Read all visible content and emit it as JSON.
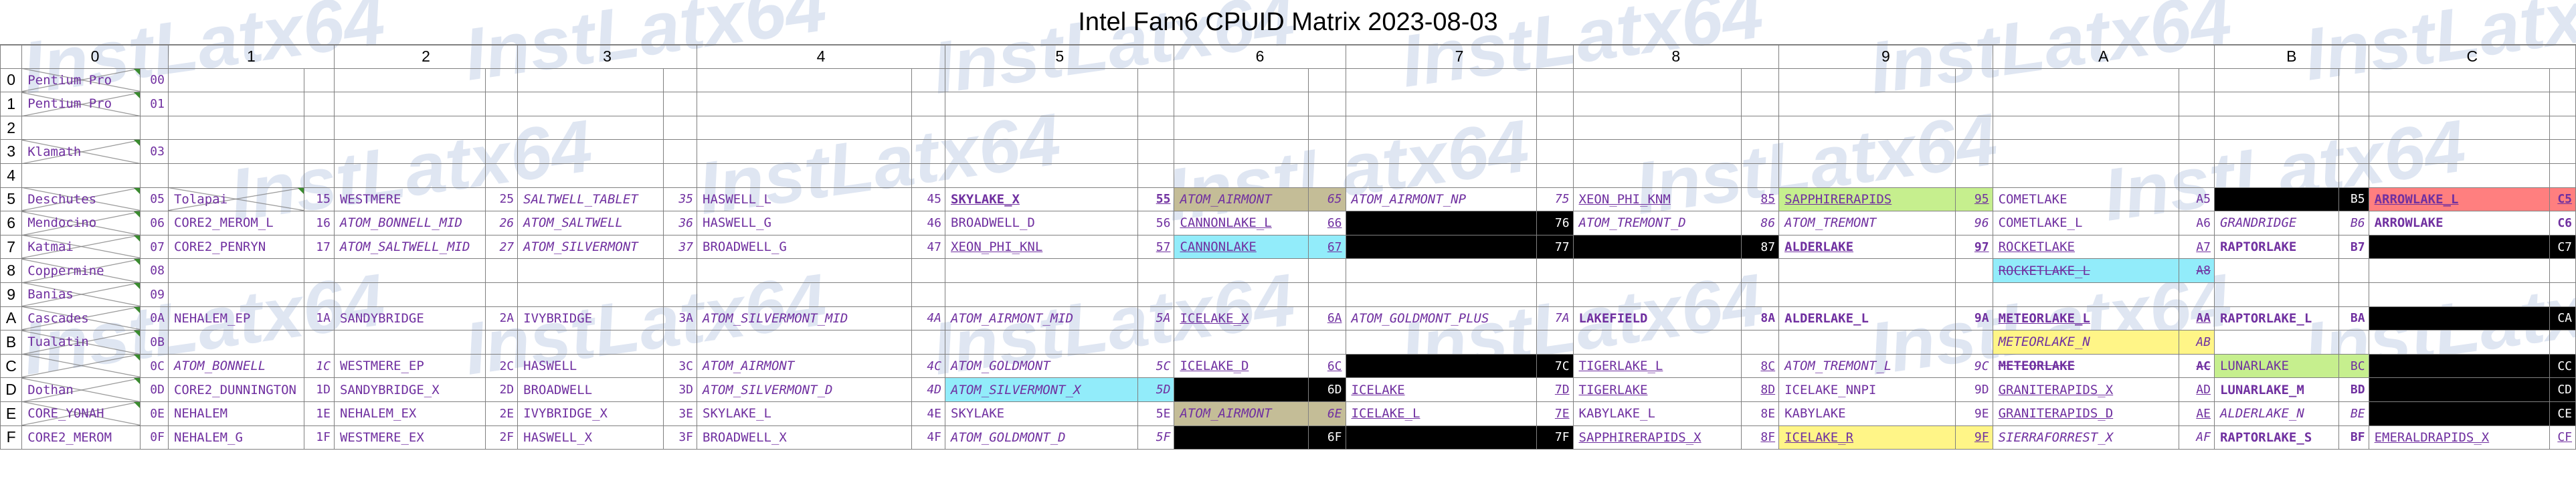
{
  "title": "Intel Fam6 CPUID Matrix 2023-08-03",
  "watermark": "InstLatx64",
  "colors": {
    "text": "#7030a0",
    "grid": "#808080",
    "black": "#000000",
    "tan": "#c4bd97",
    "cyan": "#92ecfa",
    "green": "#c6ef8e",
    "yellow": "#fff587",
    "red": "#ff7f7f"
  },
  "col_headers": [
    "0",
    "1",
    "2",
    "3",
    "4",
    "5",
    "6",
    "7",
    "8",
    "9",
    "A",
    "B",
    "C"
  ],
  "row_headers": [
    "0",
    "1",
    "2",
    "3",
    "4",
    "5",
    "6",
    "7",
    "8",
    "9",
    "A",
    "B",
    "C",
    "D",
    "E",
    "F"
  ],
  "rows": [
    [
      [
        "Pentium Pro",
        "00",
        "",
        "x"
      ],
      [
        "",
        "",
        "",
        ""
      ],
      [
        "",
        "",
        "",
        ""
      ],
      [
        "",
        "",
        "",
        ""
      ],
      [
        "",
        "",
        "",
        ""
      ],
      [
        "",
        "",
        "",
        ""
      ],
      [
        "",
        "",
        "",
        ""
      ],
      [
        "",
        "",
        "",
        ""
      ],
      [
        "",
        "",
        "",
        ""
      ],
      [
        "",
        "",
        "",
        ""
      ],
      [
        "",
        "",
        "",
        ""
      ],
      [
        "",
        "",
        "",
        ""
      ],
      [
        "",
        "",
        "",
        ""
      ]
    ],
    [
      [
        "Pentium Pro",
        "01",
        "",
        "x"
      ],
      [
        "",
        "",
        "",
        ""
      ],
      [
        "",
        "",
        "",
        ""
      ],
      [
        "",
        "",
        "",
        ""
      ],
      [
        "",
        "",
        "",
        ""
      ],
      [
        "",
        "",
        "",
        ""
      ],
      [
        "",
        "",
        "",
        ""
      ],
      [
        "",
        "",
        "",
        ""
      ],
      [
        "",
        "",
        "",
        ""
      ],
      [
        "",
        "",
        "",
        ""
      ],
      [
        "",
        "",
        "",
        ""
      ],
      [
        "",
        "",
        "",
        ""
      ],
      [
        "",
        "",
        "",
        ""
      ]
    ],
    [
      [
        "",
        "",
        "",
        ""
      ],
      [
        "",
        "",
        "",
        ""
      ],
      [
        "",
        "",
        "",
        ""
      ],
      [
        "",
        "",
        "",
        ""
      ],
      [
        "",
        "",
        "",
        ""
      ],
      [
        "",
        "",
        "",
        ""
      ],
      [
        "",
        "",
        "",
        ""
      ],
      [
        "",
        "",
        "",
        ""
      ],
      [
        "",
        "",
        "",
        ""
      ],
      [
        "",
        "",
        "",
        ""
      ],
      [
        "",
        "",
        "",
        ""
      ],
      [
        "",
        "",
        "",
        ""
      ],
      [
        "",
        "",
        "",
        ""
      ]
    ],
    [
      [
        "Klamath",
        "03",
        "",
        "x"
      ],
      [
        "",
        "",
        "",
        ""
      ],
      [
        "",
        "",
        "",
        ""
      ],
      [
        "",
        "",
        "",
        ""
      ],
      [
        "",
        "",
        "",
        ""
      ],
      [
        "",
        "",
        "",
        ""
      ],
      [
        "",
        "",
        "",
        ""
      ],
      [
        "",
        "",
        "",
        ""
      ],
      [
        "",
        "",
        "",
        ""
      ],
      [
        "",
        "",
        "",
        ""
      ],
      [
        "",
        "",
        "",
        ""
      ],
      [
        "",
        "",
        "",
        ""
      ],
      [
        "",
        "",
        "",
        ""
      ]
    ],
    [
      [
        "",
        "",
        "",
        ""
      ],
      [
        "",
        "",
        "",
        ""
      ],
      [
        "",
        "",
        "",
        ""
      ],
      [
        "",
        "",
        "",
        ""
      ],
      [
        "",
        "",
        "",
        ""
      ],
      [
        "",
        "",
        "",
        ""
      ],
      [
        "",
        "",
        "",
        ""
      ],
      [
        "",
        "",
        "",
        ""
      ],
      [
        "",
        "",
        "",
        ""
      ],
      [
        "",
        "",
        "",
        ""
      ],
      [
        "",
        "",
        "",
        ""
      ],
      [
        "",
        "",
        "",
        ""
      ],
      [
        "",
        "",
        "",
        ""
      ]
    ],
    [
      [
        "Deschutes",
        "05",
        "",
        "x"
      ],
      [
        "Tolapai",
        "15",
        "",
        "x"
      ],
      [
        "WESTMERE",
        "25",
        "",
        ""
      ],
      [
        "SALTWELL_TABLET",
        "35",
        "",
        "i"
      ],
      [
        "HASWELL_L",
        "45",
        "",
        ""
      ],
      [
        "SKYLAKE_X",
        "55",
        "",
        "u b"
      ],
      [
        "ATOM_AIRMONT",
        "65",
        "tan",
        "i"
      ],
      [
        "ATOM_AIRMONT_NP",
        "75",
        "",
        "i"
      ],
      [
        "XEON_PHI_KNM",
        "85",
        "",
        "u"
      ],
      [
        "SAPPHIRERAPIDS",
        "95",
        "green",
        "u"
      ],
      [
        "COMETLAKE",
        "A5",
        "",
        ""
      ],
      [
        "",
        "B5",
        "black",
        ""
      ],
      [
        "ARROWLAKE_L",
        "C5",
        "red",
        "u b"
      ]
    ],
    [
      [
        "Mendocino",
        "06",
        "",
        "x"
      ],
      [
        "CORE2_MEROM_L",
        "16",
        "",
        ""
      ],
      [
        "ATOM_BONNELL_MID",
        "26",
        "",
        "i"
      ],
      [
        "ATOM_SALTWELL",
        "36",
        "",
        "i"
      ],
      [
        "HASWELL_G",
        "46",
        "",
        ""
      ],
      [
        "BROADWELL_D",
        "56",
        "",
        ""
      ],
      [
        "CANNONLAKE_L",
        "66",
        "",
        "u"
      ],
      [
        "",
        "76",
        "black",
        ""
      ],
      [
        "ATOM_TREMONT_D",
        "86",
        "",
        "i"
      ],
      [
        "ATOM_TREMONT",
        "96",
        "",
        "i"
      ],
      [
        "COMETLAKE_L",
        "A6",
        "",
        ""
      ],
      [
        "GRANDRIDGE",
        "B6",
        "",
        "i"
      ],
      [
        "ARROWLAKE",
        "C6",
        "",
        "b"
      ]
    ],
    [
      [
        "Katmai",
        "07",
        "",
        "x"
      ],
      [
        "CORE2_PENRYN",
        "17",
        "",
        ""
      ],
      [
        "ATOM_SALTWELL_MID",
        "27",
        "",
        "i"
      ],
      [
        "ATOM_SILVERMONT",
        "37",
        "",
        "i"
      ],
      [
        "BROADWELL_G",
        "47",
        "",
        ""
      ],
      [
        "XEON_PHI_KNL",
        "57",
        "",
        "u"
      ],
      [
        "CANNONLAKE",
        "67",
        "cyan",
        "u"
      ],
      [
        "",
        "77",
        "black",
        ""
      ],
      [
        "",
        "87",
        "black",
        ""
      ],
      [
        "ALDERLAKE",
        "97",
        "",
        "u b"
      ],
      [
        "ROCKETLAKE",
        "A7",
        "",
        "u"
      ],
      [
        "RAPTORLAKE",
        "B7",
        "",
        "b"
      ],
      [
        "",
        "C7",
        "black",
        ""
      ]
    ],
    [
      [
        "Coppermine",
        "08",
        "",
        "x"
      ],
      [
        "",
        "",
        "",
        ""
      ],
      [
        "",
        "",
        "",
        ""
      ],
      [
        "",
        "",
        "",
        ""
      ],
      [
        "",
        "",
        "",
        ""
      ],
      [
        "",
        "",
        "",
        ""
      ],
      [
        "",
        "",
        "",
        ""
      ],
      [
        "",
        "",
        "",
        ""
      ],
      [
        "",
        "",
        "",
        ""
      ],
      [
        "",
        "",
        "",
        ""
      ],
      [
        "ROCKETLAKE_L",
        "A8",
        "cyan",
        "u s"
      ],
      [
        "",
        "",
        "",
        ""
      ],
      [
        "",
        "",
        "",
        ""
      ]
    ],
    [
      [
        "Banias",
        "09",
        "",
        "x"
      ],
      [
        "",
        "",
        "",
        ""
      ],
      [
        "",
        "",
        "",
        ""
      ],
      [
        "",
        "",
        "",
        ""
      ],
      [
        "",
        "",
        "",
        ""
      ],
      [
        "",
        "",
        "",
        ""
      ],
      [
        "",
        "",
        "",
        ""
      ],
      [
        "",
        "",
        "",
        ""
      ],
      [
        "",
        "",
        "",
        ""
      ],
      [
        "",
        "",
        "",
        ""
      ],
      [
        "",
        "",
        "",
        ""
      ],
      [
        "",
        "",
        "",
        ""
      ],
      [
        "",
        "",
        "",
        ""
      ]
    ],
    [
      [
        "Cascades",
        "0A",
        "",
        "x"
      ],
      [
        "NEHALEM_EP",
        "1A",
        "",
        ""
      ],
      [
        "SANDYBRIDGE",
        "2A",
        "",
        ""
      ],
      [
        "IVYBRIDGE",
        "3A",
        "",
        ""
      ],
      [
        "ATOM_SILVERMONT_MID",
        "4A",
        "",
        "i"
      ],
      [
        "ATOM_AIRMONT_MID",
        "5A",
        "",
        "i"
      ],
      [
        "ICELAKE_X",
        "6A",
        "",
        "u"
      ],
      [
        "ATOM_GOLDMONT_PLUS",
        "7A",
        "",
        "i"
      ],
      [
        "LAKEFIELD",
        "8A",
        "",
        "b"
      ],
      [
        "ALDERLAKE_L",
        "9A",
        "",
        "b"
      ],
      [
        "METEORLAKE_L",
        "AA",
        "",
        "u b"
      ],
      [
        "RAPTORLAKE_L",
        "BA",
        "",
        "b"
      ],
      [
        "",
        "CA",
        "black",
        ""
      ]
    ],
    [
      [
        "Tualatin",
        "0B",
        "",
        "x"
      ],
      [
        "",
        "",
        "",
        ""
      ],
      [
        "",
        "",
        "",
        ""
      ],
      [
        "",
        "",
        "",
        ""
      ],
      [
        "",
        "",
        "",
        ""
      ],
      [
        "",
        "",
        "",
        ""
      ],
      [
        "",
        "",
        "",
        ""
      ],
      [
        "",
        "",
        "",
        ""
      ],
      [
        "",
        "",
        "",
        ""
      ],
      [
        "",
        "",
        "",
        ""
      ],
      [
        "METEORLAKE_N",
        "AB",
        "yellow",
        "i"
      ],
      [
        "",
        "",
        "",
        ""
      ],
      [
        "",
        "",
        "",
        ""
      ]
    ],
    [
      [
        "",
        "0C",
        "",
        "x"
      ],
      [
        "ATOM_BONNELL",
        "1C",
        "",
        "i"
      ],
      [
        "WESTMERE_EP",
        "2C",
        "",
        ""
      ],
      [
        "HASWELL",
        "3C",
        "",
        ""
      ],
      [
        "ATOM_AIRMONT",
        "4C",
        "",
        "i"
      ],
      [
        "ATOM_GOLDMONT",
        "5C",
        "",
        "i"
      ],
      [
        "ICELAKE_D",
        "6C",
        "",
        "u"
      ],
      [
        "",
        "7C",
        "black",
        ""
      ],
      [
        "TIGERLAKE_L",
        "8C",
        "",
        "u"
      ],
      [
        "ATOM_TREMONT_L",
        "9C",
        "",
        "i"
      ],
      [
        "METEORLAKE",
        "AC",
        "",
        "b s"
      ],
      [
        "LUNARLAKE",
        "BC",
        "green",
        ""
      ],
      [
        "",
        "CC",
        "black",
        ""
      ]
    ],
    [
      [
        "Dothan",
        "0D",
        "",
        "x"
      ],
      [
        "CORE2_DUNNINGTON",
        "1D",
        "",
        ""
      ],
      [
        "SANDYBRIDGE_X",
        "2D",
        "",
        ""
      ],
      [
        "BROADWELL",
        "3D",
        "",
        ""
      ],
      [
        "ATOM_SILVERMONT_D",
        "4D",
        "",
        "i"
      ],
      [
        "ATOM_SILVERMONT_X",
        "5D",
        "cyan",
        "i"
      ],
      [
        "",
        "6D",
        "black",
        ""
      ],
      [
        "ICELAKE",
        "7D",
        "",
        "u"
      ],
      [
        "TIGERLAKE",
        "8D",
        "",
        "u"
      ],
      [
        "ICELAKE_NNPI",
        "9D",
        "",
        ""
      ],
      [
        "GRANITERAPIDS_X",
        "AD",
        "",
        "u"
      ],
      [
        "LUNARLAKE_M",
        "BD",
        "",
        "b"
      ],
      [
        "",
        "CD",
        "black",
        ""
      ]
    ],
    [
      [
        "CORE_YONAH",
        "0E",
        "",
        "x"
      ],
      [
        "NEHALEM",
        "1E",
        "",
        ""
      ],
      [
        "NEHALEM_EX",
        "2E",
        "",
        ""
      ],
      [
        "IVYBRIDGE_X",
        "3E",
        "",
        ""
      ],
      [
        "SKYLAKE_L",
        "4E",
        "",
        ""
      ],
      [
        "SKYLAKE",
        "5E",
        "",
        ""
      ],
      [
        "ATOM_AIRMONT",
        "6E",
        "tan",
        "i"
      ],
      [
        "ICELAKE_L",
        "7E",
        "",
        "u"
      ],
      [
        "KABYLAKE_L",
        "8E",
        "",
        ""
      ],
      [
        "KABYLAKE",
        "9E",
        "",
        ""
      ],
      [
        "GRANITERAPIDS_D",
        "AE",
        "",
        "u"
      ],
      [
        "ALDERLAKE_N",
        "BE",
        "",
        "i"
      ],
      [
        "",
        "CE",
        "black",
        ""
      ]
    ],
    [
      [
        "CORE2_MEROM",
        "0F",
        "",
        ""
      ],
      [
        "NEHALEM_G",
        "1F",
        "",
        ""
      ],
      [
        "WESTMERE_EX",
        "2F",
        "",
        ""
      ],
      [
        "HASWELL_X",
        "3F",
        "",
        ""
      ],
      [
        "BROADWELL_X",
        "4F",
        "",
        ""
      ],
      [
        "ATOM_GOLDMONT_D",
        "5F",
        "",
        "i"
      ],
      [
        "",
        "6F",
        "black",
        ""
      ],
      [
        "",
        "7F",
        "black",
        ""
      ],
      [
        "SAPPHIRERAPIDS_X",
        "8F",
        "",
        "u"
      ],
      [
        "ICELAKE_R",
        "9F",
        "yellow",
        "u"
      ],
      [
        "SIERRAFORREST_X",
        "AF",
        "",
        "i"
      ],
      [
        "RAPTORLAKE_S",
        "BF",
        "",
        "b"
      ],
      [
        "EMERALDRAPIDS_X",
        "CF",
        "",
        "u"
      ]
    ]
  ]
}
